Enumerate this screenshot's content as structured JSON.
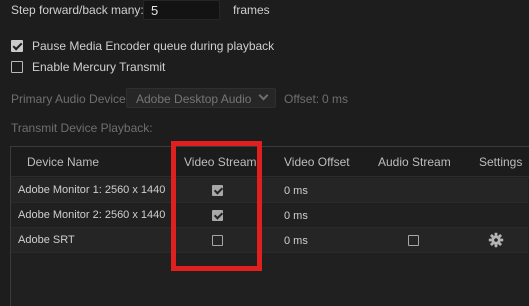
{
  "step": {
    "label": "Step forward/back many:",
    "value": "5",
    "unit": "frames"
  },
  "options": [
    {
      "label": "Pause Media Encoder queue during playback",
      "checked": true
    },
    {
      "label": "Enable Mercury Transmit",
      "checked": false
    }
  ],
  "audio": {
    "label": "Primary Audio Device:",
    "value": "Adobe Desktop Audio",
    "offset_label": "Offset:",
    "offset_value": "0 ms"
  },
  "transmit": {
    "section_label": "Transmit Device Playback:",
    "columns": [
      "Device Name",
      "Video Stream",
      "Video Offset",
      "Audio Stream",
      "Settings"
    ],
    "rows": [
      {
        "device": "Adobe Monitor 1: 2560 x 1440",
        "video_stream": true,
        "video_offset": "0 ms",
        "audio_stream": null,
        "settings": false
      },
      {
        "device": "Adobe Monitor 2: 2560 x 1440",
        "video_stream": true,
        "video_offset": "0 ms",
        "audio_stream": null,
        "settings": false
      },
      {
        "device": "Adobe SRT",
        "video_stream": false,
        "video_offset": "0 ms",
        "audio_stream": false,
        "settings": true
      }
    ]
  },
  "colors": {
    "background": "#1d1d1d",
    "highlight_box": "#e0201f"
  },
  "icons": {
    "settings": "gear-icon",
    "dropdown": "chevron-down-icon"
  }
}
